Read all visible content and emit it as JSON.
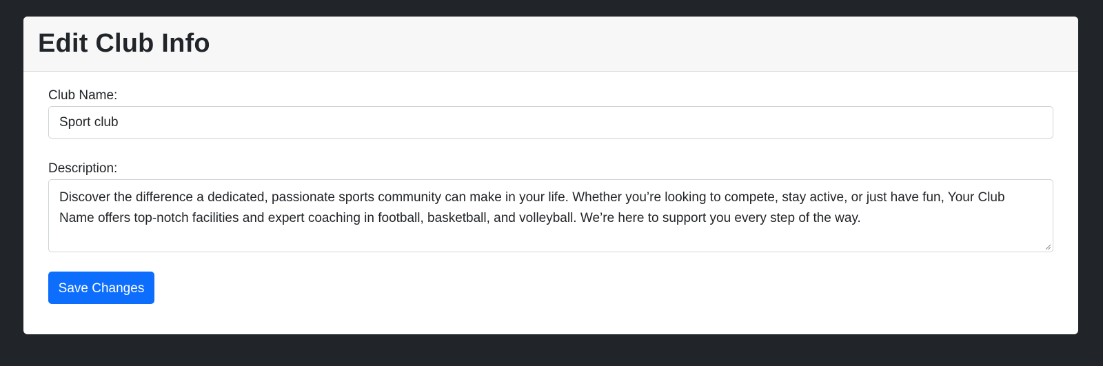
{
  "card": {
    "title": "Edit Club Info"
  },
  "form": {
    "club_name_label": "Club Name:",
    "club_name_value": "Sport club",
    "description_label": "Description:",
    "description_value": "Discover the difference a dedicated, passionate sports community can make in your life. Whether you’re looking to compete, stay active, or just have fun, Your Club Name offers top-notch facilities and expert coaching in football, basketball, and volleyball. We’re here to support you every step of the way.",
    "save_label": "Save Changes"
  },
  "colors": {
    "page_background": "#212529",
    "card_background": "#ffffff",
    "header_background": "#f7f7f7",
    "primary_button": "#0d6efd"
  }
}
